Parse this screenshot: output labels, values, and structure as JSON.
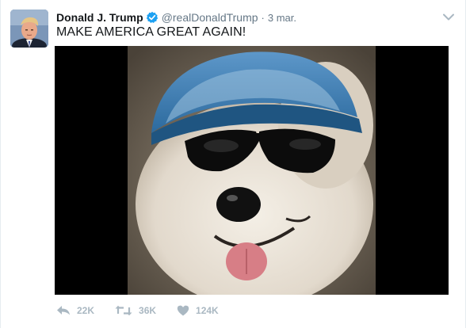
{
  "tweet": {
    "author_name": "Donald J. Trump",
    "author_handle": "@realDonaldTrump",
    "separator": "·",
    "date": "3 mar.",
    "text": "MAKE AMERICA GREAT AGAIN!",
    "verified_icon": "verified-badge-icon",
    "menu_icon": "chevron-down-icon",
    "media": {
      "description_icon": "photo-dog-with-cap-and-sunglasses",
      "background_color": "#000000"
    },
    "actions": {
      "reply_icon": "reply-icon",
      "reply_count": "22K",
      "retweet_icon": "retweet-icon",
      "retweet_count": "36K",
      "like_icon": "heart-icon",
      "like_count": "124K"
    },
    "colors": {
      "accent": "#1da1f2",
      "muted_text": "#657786",
      "action_gray": "#aab8c2"
    }
  }
}
